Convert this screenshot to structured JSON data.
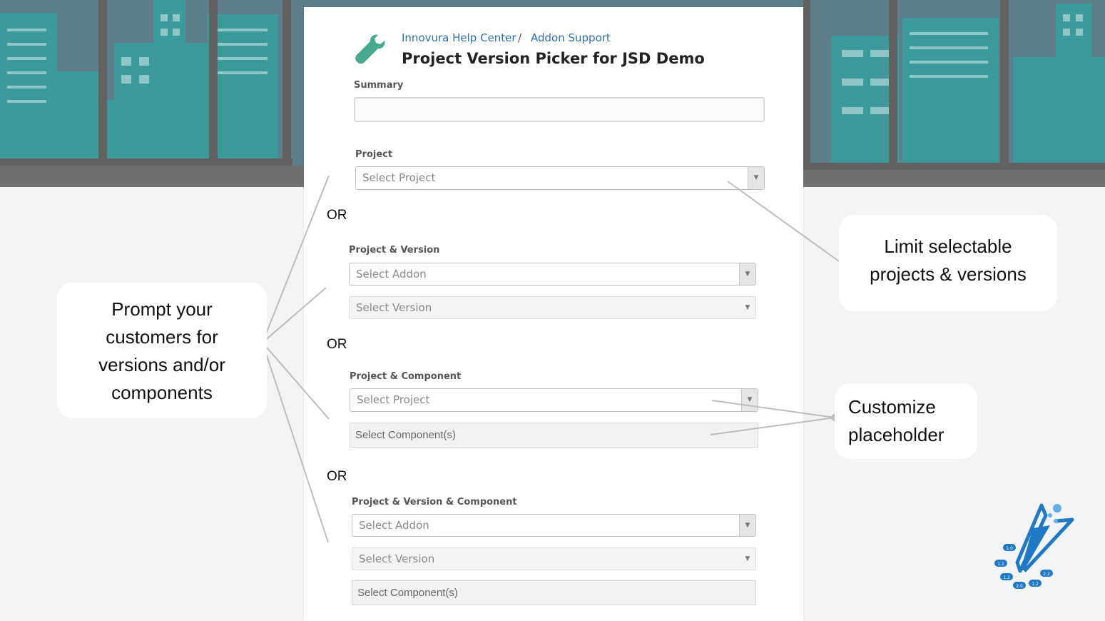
{
  "breadcrumb": {
    "help_center": "Innovura Help Center",
    "separator": "/",
    "addon_support": "Addon Support"
  },
  "page_title": "Project Version Picker for JSD Demo",
  "summary": {
    "label": "Summary",
    "value": ""
  },
  "project": {
    "label": "Project",
    "placeholder": "Select Project"
  },
  "or_text": "OR",
  "project_version": {
    "label": "Project & Version",
    "addon_placeholder": "Select Addon",
    "version_placeholder": "Select Version"
  },
  "project_component": {
    "label": "Project & Component",
    "project_placeholder": "Select Project",
    "component_placeholder": "Select Component(s)"
  },
  "project_version_component": {
    "label": "Project & Version & Component",
    "addon_placeholder": "Select Addon",
    "version_placeholder": "Select Version",
    "component_placeholder": "Select Component(s)"
  },
  "callouts": {
    "prompt": [
      "Prompt your",
      "customers for",
      "versions and/or",
      "components"
    ],
    "limit": [
      "Limit selectable",
      "projects & versions"
    ],
    "customize": [
      "Customize",
      "placeholder"
    ]
  },
  "logo_badges": [
    "1.0",
    "1.1",
    "1.2",
    "2.0",
    "1.2",
    "2.2"
  ],
  "colors": {
    "sky": "#5e7f8a",
    "building": "#3d9a9a",
    "window_frame": "#616161",
    "link": "#2c6fb4",
    "wrench": "#46a98f",
    "logo": "#1f79c4",
    "callout_line": "#bdbdbd"
  }
}
